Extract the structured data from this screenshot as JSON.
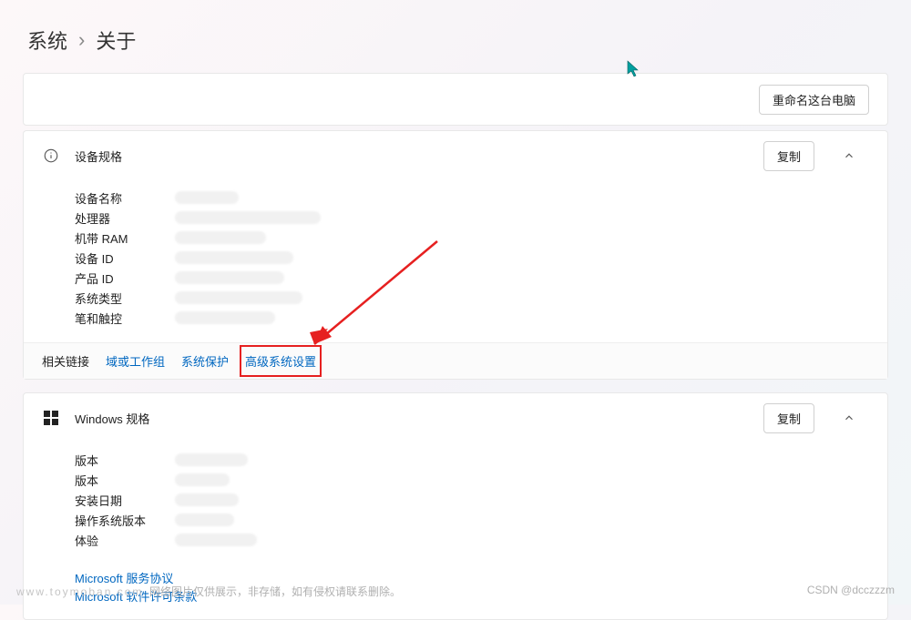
{
  "breadcrumb": {
    "parent": "系统",
    "sep": "›",
    "current": "关于"
  },
  "rename": {
    "btn": "重命名这台电脑"
  },
  "device": {
    "title": "设备规格",
    "copy": "复制",
    "rows": [
      {
        "label": "设备名称"
      },
      {
        "label": "处理器"
      },
      {
        "label": "机带 RAM"
      },
      {
        "label": "设备 ID"
      },
      {
        "label": "产品 ID"
      },
      {
        "label": "系统类型"
      },
      {
        "label": "笔和触控"
      }
    ]
  },
  "related": {
    "label": "相关链接",
    "links": {
      "domain": "域或工作组",
      "protect": "系统保护",
      "advanced": "高级系统设置"
    }
  },
  "windows": {
    "title": "Windows 规格",
    "copy": "复制",
    "rows": [
      {
        "label": "版本"
      },
      {
        "label": "版本"
      },
      {
        "label": "安装日期"
      },
      {
        "label": "操作系统版本"
      },
      {
        "label": "体验"
      }
    ],
    "links": {
      "tos": "Microsoft 服务协议",
      "license": "Microsoft 软件许可条款"
    }
  },
  "footer": {
    "left_site": "www.toymoban.com",
    "left_text": "网络图片仅供展示，非存储，如有侵权请联系删除。",
    "right": "CSDN @dcczzzm"
  }
}
